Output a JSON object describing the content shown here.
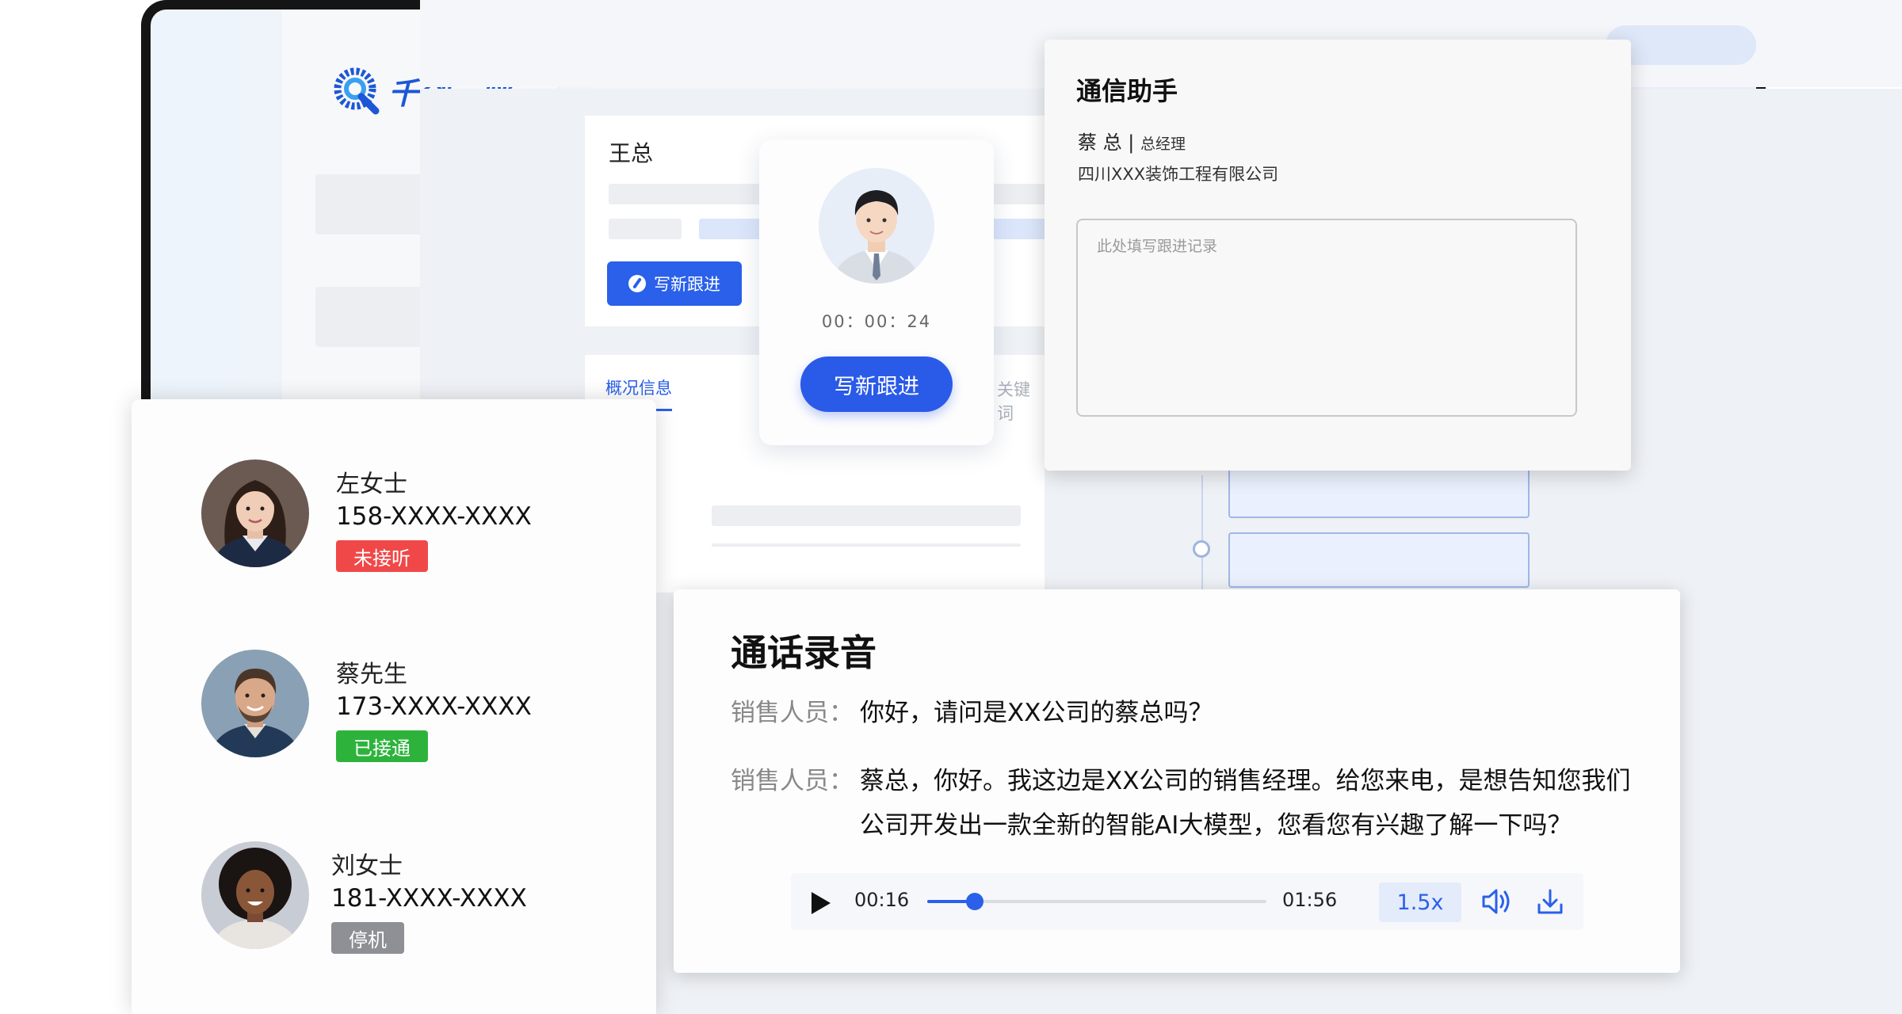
{
  "brand": {
    "name": "千创云呼",
    "color": "#1d57d6"
  },
  "customer": {
    "name": "王总",
    "follow_btn": "写新跟进"
  },
  "tabs": {
    "active": "概况信息",
    "other": "关键词"
  },
  "call": {
    "timer": "00：00：24",
    "button": "写新跟进"
  },
  "assistant": {
    "title": "通信助手",
    "person_name": "蔡 总",
    "separator": "|",
    "person_role": "总经理",
    "company": "四川XXX装饰工程有限公司",
    "notes_placeholder": "此处填写跟进记录"
  },
  "contacts": [
    {
      "name": "左女士",
      "phone": "158-XXXX-XXXX",
      "status": "未接听",
      "status_color": "#f04848"
    },
    {
      "name": "蔡先生",
      "phone": "173-XXXX-XXXX",
      "status": "已接通",
      "status_color": "#2db33c"
    },
    {
      "name": "刘女士",
      "phone": "181-XXXX-XXXX",
      "status": "停机",
      "status_color": "#8e9096"
    }
  ],
  "recording": {
    "title": "通话录音",
    "lines": [
      {
        "speaker": "销售人员：",
        "text": "你好，请问是XX公司的蔡总吗？"
      },
      {
        "speaker": "销售人员：",
        "text": "蔡总，你好。我这边是XX公司的销售经理。给您来电，是想告知您我们公司开发出一款全新的智能AI大模型，您看您有兴趣了解一下吗？"
      }
    ],
    "player": {
      "current": "00:16",
      "duration": "01:56",
      "progress": 0.14,
      "speed": "1.5x",
      "icons": [
        "play-icon",
        "volume-icon",
        "download-icon"
      ]
    }
  },
  "colors": {
    "accent": "#2a60ea"
  }
}
